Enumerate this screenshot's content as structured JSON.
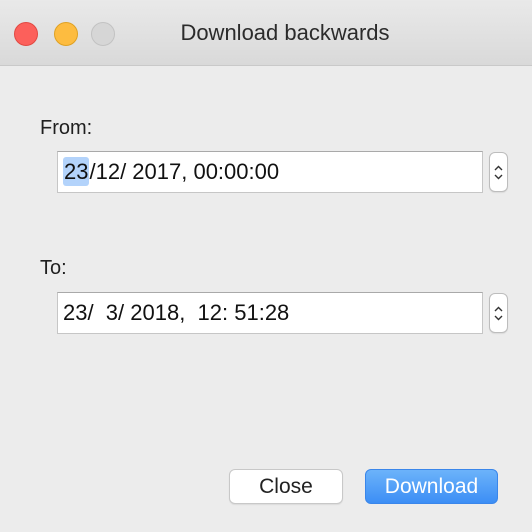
{
  "window": {
    "title": "Download backwards"
  },
  "from": {
    "label": "From:",
    "selected_segment": "23",
    "value_rest": "/12/ 2017, 00:00:00"
  },
  "to": {
    "label": "To:",
    "value": "23/  3/ 2018,  12: 51:28"
  },
  "buttons": {
    "close": "Close",
    "download": "Download"
  },
  "colors": {
    "accent": "#3c8ef5",
    "selection": "#b3d3fb",
    "traffic_close": "#fc605b",
    "traffic_minimize": "#fdbc40",
    "traffic_zoom_disabled": "#d6d6d6"
  },
  "icons": {
    "stepper": "chevron-up-down-icon"
  }
}
